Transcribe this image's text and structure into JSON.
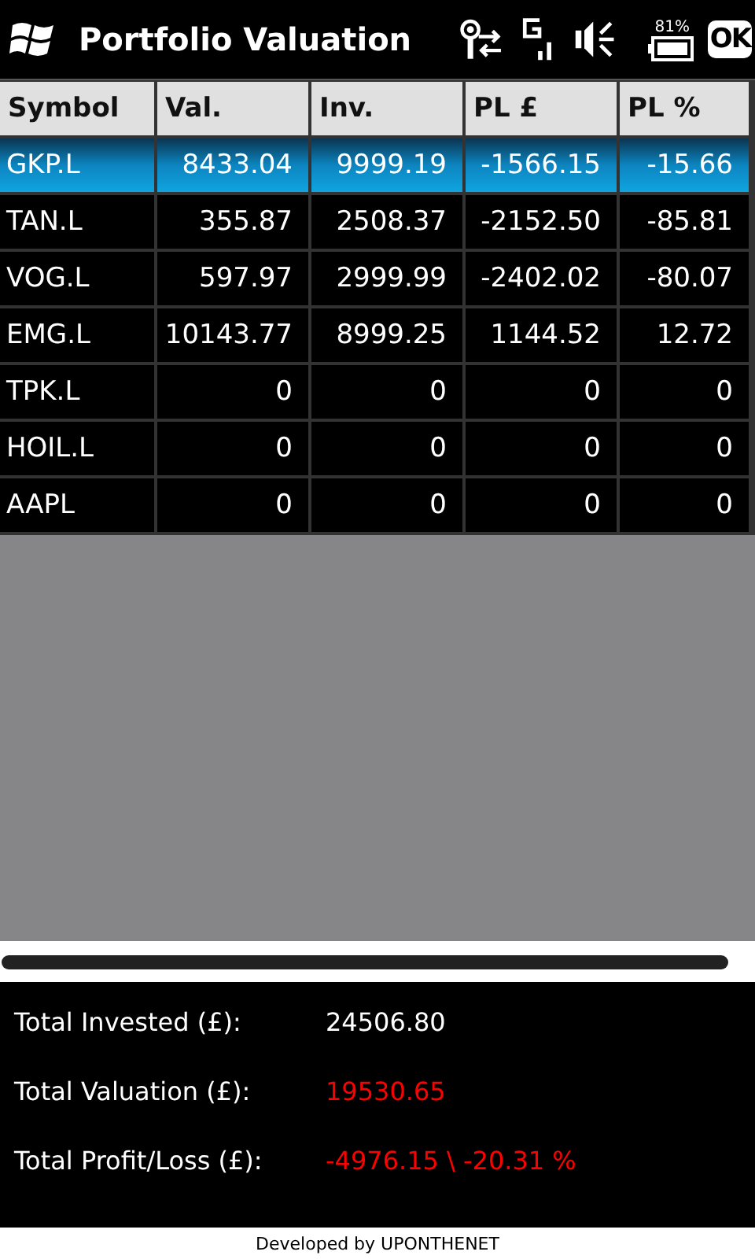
{
  "title_bar": {
    "title": "Portfolio Valuation",
    "battery_text": "81%",
    "ok_button": "OK"
  },
  "table": {
    "columns": [
      "Symbol",
      "Val.",
      "Inv.",
      "PL £",
      "PL %"
    ],
    "rows": [
      {
        "cells": [
          "GKP.L",
          "8433.04",
          "9999.19",
          "-1566.15",
          "-15.66"
        ],
        "selected": true
      },
      {
        "cells": [
          "TAN.L",
          "355.87",
          "2508.37",
          "-2152.50",
          "-85.81"
        ],
        "selected": false
      },
      {
        "cells": [
          "VOG.L",
          "597.97",
          "2999.99",
          "-2402.02",
          "-80.07"
        ],
        "selected": false
      },
      {
        "cells": [
          "EMG.L",
          "10143.77",
          "8999.25",
          "1144.52",
          "12.72"
        ],
        "selected": false
      },
      {
        "cells": [
          "TPK.L",
          "0",
          "0",
          "0",
          "0"
        ],
        "selected": false
      },
      {
        "cells": [
          "HOIL.L",
          "0",
          "0",
          "0",
          "0"
        ],
        "selected": false
      },
      {
        "cells": [
          "AAPL",
          "0",
          "0",
          "0",
          "0"
        ],
        "selected": false
      }
    ]
  },
  "totals": [
    {
      "label": "Total Invested (£):",
      "value": "24506.80",
      "color": "#ffffff"
    },
    {
      "label": "Total Valuation (£):",
      "value": "19530.65",
      "color": "#ff0000"
    },
    {
      "label": "Total Profit/Loss (£):",
      "value": "-4976.15 \\ -20.31 %",
      "color": "#ff0000"
    }
  ],
  "footer": "Developed by UPONTHENET"
}
